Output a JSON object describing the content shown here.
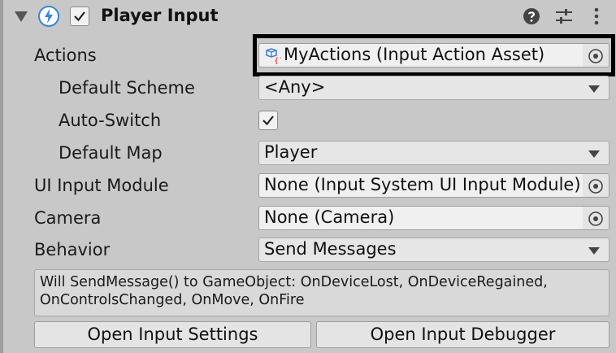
{
  "component": {
    "title": "Player Input",
    "enabled": true
  },
  "rows": {
    "actions": {
      "label": "Actions",
      "value": "MyActions (Input Action Asset)"
    },
    "default_scheme": {
      "label": "Default Scheme",
      "value": "<Any>"
    },
    "auto_switch": {
      "label": "Auto-Switch",
      "checked": true
    },
    "default_map": {
      "label": "Default Map",
      "value": "Player"
    },
    "ui_input_module": {
      "label": "UI Input Module",
      "value": "None (Input System UI Input Module)"
    },
    "camera": {
      "label": "Camera",
      "value": "None (Camera)"
    },
    "behavior": {
      "label": "Behavior",
      "value": "Send Messages"
    }
  },
  "help": {
    "line1": "Will SendMessage() to GameObject: OnDeviceLost, OnDeviceRegained,",
    "line2": "OnControlsChanged, OnMove, OnFire"
  },
  "buttons": {
    "open_settings": "Open Input Settings",
    "open_debugger": "Open Input Debugger"
  },
  "colors": {
    "background": "#c8c8c8",
    "field": "#f0f0f0",
    "component_icon": "#3a86d8",
    "highlight_border": "#000000"
  }
}
